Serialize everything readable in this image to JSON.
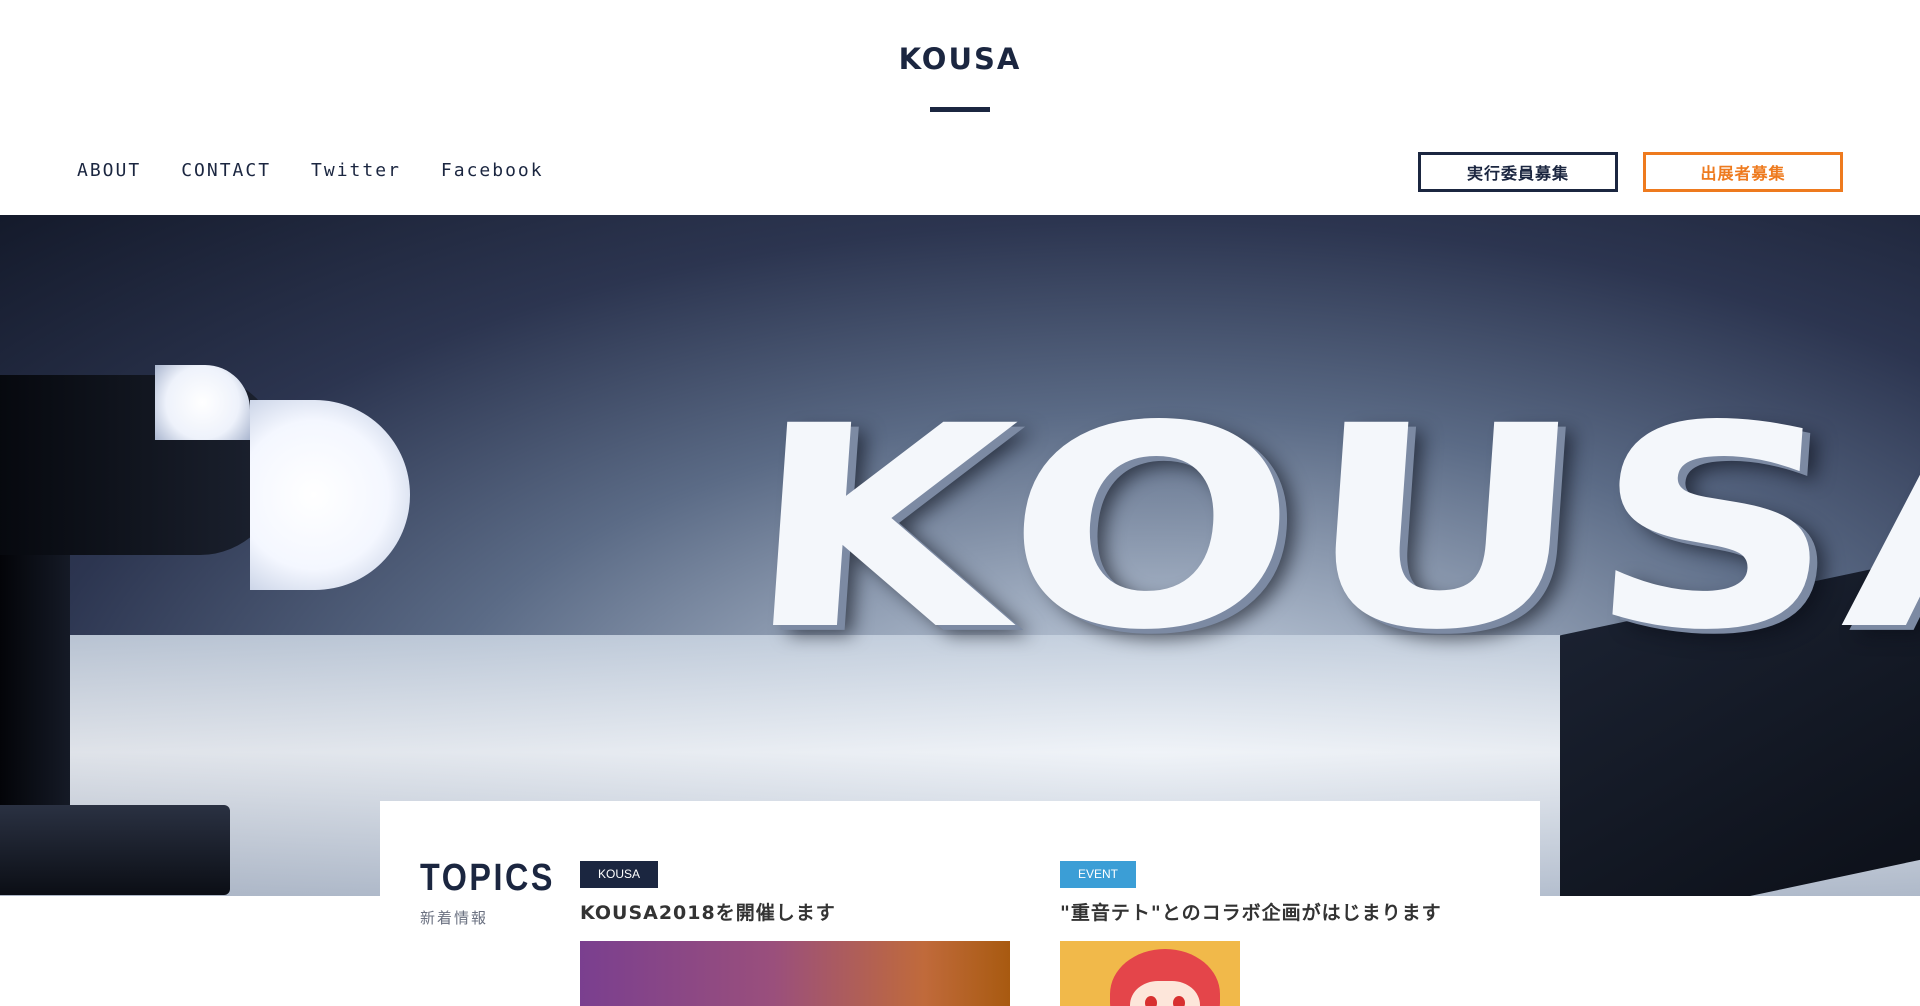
{
  "header": {
    "site_title": "KOUSA",
    "nav": [
      {
        "label": "ABOUT"
      },
      {
        "label": "CONTACT"
      },
      {
        "label": "Twitter"
      },
      {
        "label": "Facebook"
      }
    ],
    "buttons": {
      "committee_label": "実行委員募集",
      "exhibitor_label": "出展者募集"
    }
  },
  "hero": {
    "word": "KOUSA"
  },
  "topics": {
    "title": "TOPICS",
    "subtitle": "新着情報",
    "posts": [
      {
        "tag": "KOUSA",
        "title": "KOUSA2018を開催します"
      },
      {
        "tag": "EVENT",
        "title": "\"重音テト\"とのコラボ企画がはじまります"
      }
    ]
  },
  "colors": {
    "navy": "#1b2640",
    "orange": "#ee7a1e",
    "event_blue": "#3b9ed6"
  }
}
